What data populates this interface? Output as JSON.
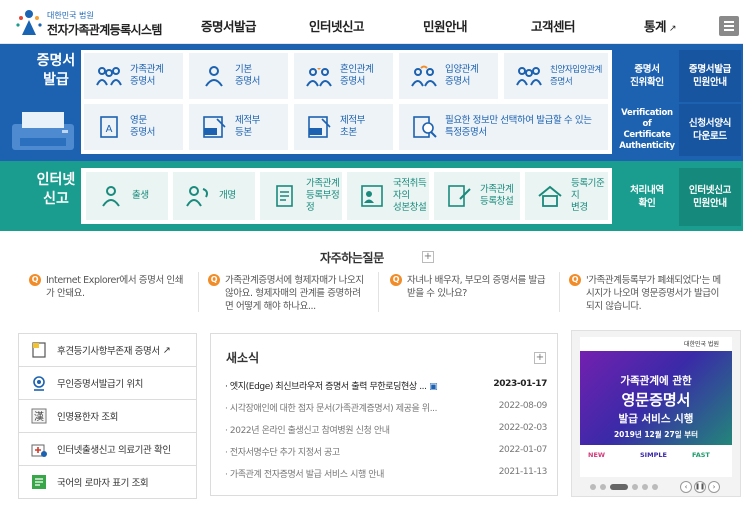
{
  "header": {
    "logo_small": "대한민국 법원",
    "logo_title": "전자가족관계등록시스템",
    "nav": [
      {
        "label": "증명서발급"
      },
      {
        "label": "인터넷신고"
      },
      {
        "label": "민원안내"
      },
      {
        "label": "고객센터"
      },
      {
        "label": "통계"
      }
    ]
  },
  "issue": {
    "title": "증명서\n발급",
    "tiles": [
      {
        "label": "가족관계\n증명서",
        "icon": "family-icon"
      },
      {
        "label": "기본\n증명서",
        "icon": "person-icon"
      },
      {
        "label": "혼인관계\n증명서",
        "icon": "couple-icon"
      },
      {
        "label": "입양관계\n증명서",
        "icon": "adoption-icon"
      },
      {
        "label": "친양자입양관계\n증명서",
        "icon": "family-adoption-icon"
      },
      {
        "label": "영문\n증명서",
        "icon": "english-document-icon"
      },
      {
        "label": "제적부\n등본",
        "icon": "removed-register-icon"
      },
      {
        "label": "제적부\n초본",
        "icon": "removed-register-extract-icon"
      },
      {
        "label": "필요한 정보만 선택하여 발급할 수 있는\n특정증명서",
        "icon": "search-document-icon"
      }
    ],
    "side": [
      {
        "label": "증명서\n진위확인"
      },
      {
        "label": "증명서발급\n민원안내"
      },
      {
        "label": "Verification of\nCertificate\nAuthenticity"
      },
      {
        "label": "신청서양식\n다운로드"
      }
    ]
  },
  "report": {
    "title": "인터넷\n신고",
    "tiles": [
      {
        "label": "출생",
        "icon": "baby-icon"
      },
      {
        "label": "개명",
        "icon": "rename-icon"
      },
      {
        "label": "가족관계\n등록부정정",
        "icon": "register-correction-icon"
      },
      {
        "label": "국적취득자의\n성본창설",
        "icon": "nationality-icon"
      },
      {
        "label": "가족관계\n등록창설",
        "icon": "register-create-icon"
      },
      {
        "label": "등록기준지\n변경",
        "icon": "house-icon"
      }
    ],
    "side": [
      {
        "label": "처리내역\n확인"
      },
      {
        "label": "인터넷신고\n민원안내"
      }
    ]
  },
  "faq": {
    "title": "자주하는질문",
    "items": [
      {
        "text": "Internet Explorer에서 증명서 인쇄가 안돼요."
      },
      {
        "text": "가족관계증명서에 형제자매가 나오지 않아요. 형제자매의 관계를 증명하려면 어떻게 해야 하나요..."
      },
      {
        "text": "자녀나 배우자, 부모의 증명서를 발급받을 수 있나요?"
      },
      {
        "text": "'가족관계등록부가 폐쇄되었다'는 메시지가 나오며 영문증명서가 발급이 되지 않습니다."
      }
    ]
  },
  "quick_links": [
    {
      "label": "후견등기사항부존재 증명서",
      "icon": "document-icon",
      "external": "↗"
    },
    {
      "label": "무인증명서발급기 위치",
      "icon": "kiosk-location-icon"
    },
    {
      "label": "인명용한자 조회",
      "icon": "hanja-icon"
    },
    {
      "label": "인터넷출생신고 의료기관 확인",
      "icon": "hospital-icon"
    },
    {
      "label": "국어의 로마자 표기 조회",
      "icon": "romanization-icon"
    }
  ],
  "news": {
    "title": "새소식",
    "items": [
      {
        "title": "엣지(Edge) 최신브라우저 증명서 출력 무한로딩현상 ...",
        "date": "2023-01-17"
      },
      {
        "title": "시각장애인에 대한 점자 문서(가족관계증명서) 제공을 위...",
        "date": "2022-08-09"
      },
      {
        "title": "2022년 온라인 출생신고 참여병원 신청 안내",
        "date": "2022-02-03"
      },
      {
        "title": "전자서명수단 추가 지정서 공고",
        "date": "2022-01-07"
      },
      {
        "title": "가족관계 전자증명서 발급 서비스 시행 안내",
        "date": "2021-11-13"
      }
    ]
  },
  "banner": {
    "court": "대한민국 법원",
    "headline1": "가족관계에 관한",
    "headline2": "영문증명서",
    "headline3": "발급 서비스 시행",
    "date": "2019년 12월 27일 부터",
    "tags": [
      "NEW",
      "SIMPLE",
      "FAST"
    ]
  }
}
